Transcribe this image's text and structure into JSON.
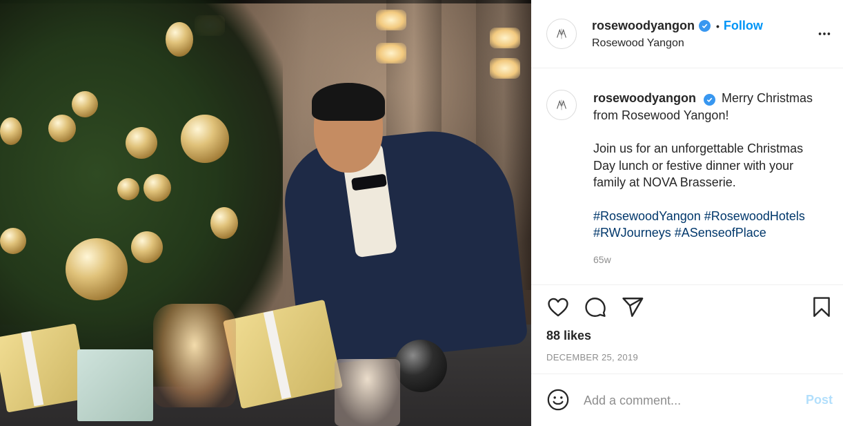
{
  "post": {
    "username": "rosewoodyangon",
    "location": "Rosewood Yangon",
    "follow_label": "Follow",
    "separator": "•",
    "verified": true,
    "caption": {
      "username": "rosewoodyangon",
      "line1": "Merry Christmas from Rosewood Yangon!",
      "line2": "Join us for an unforgettable Christmas Day lunch or festive dinner with your family at NOVA Brasserie.",
      "hashtags": "#RosewoodYangon #RosewoodHotels #RWJourneys #ASenseofPlace"
    },
    "time_ago": "65w",
    "likes": "88 likes",
    "date": "DECEMBER 25, 2019"
  },
  "comment": {
    "placeholder": "Add a comment...",
    "post_label": "Post"
  },
  "icons": {
    "heart": "heart-icon",
    "comment": "comment-icon",
    "share": "paper-plane-icon",
    "save": "bookmark-icon",
    "more": "more-dots-icon",
    "emoji": "smiley-icon",
    "verified": "verified-badge-icon"
  },
  "colors": {
    "accent": "#0095f6",
    "verified": "#3897f0",
    "hashtag": "#00376b",
    "muted": "#8e8e8e",
    "post_disabled": "#b2dffc"
  }
}
